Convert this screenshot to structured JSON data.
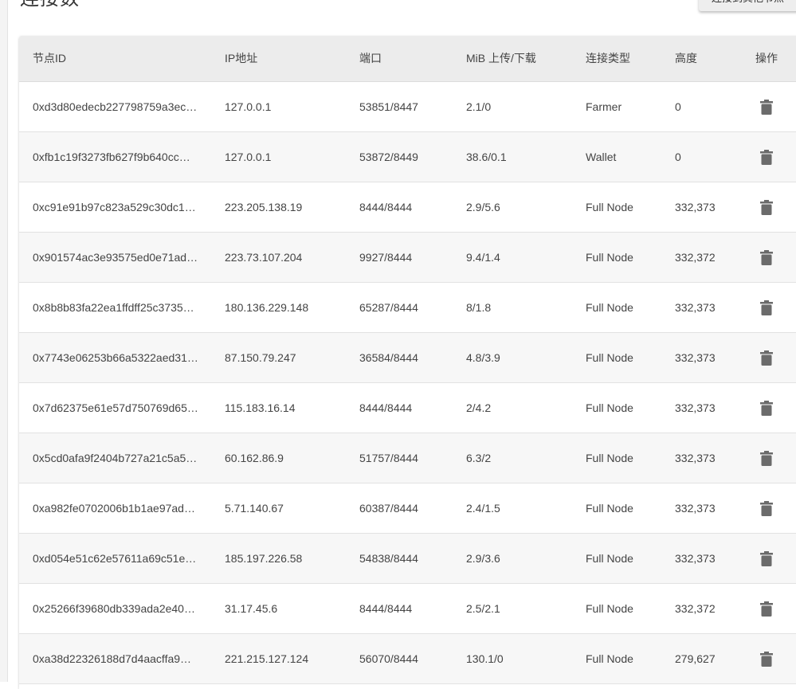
{
  "section": {
    "title": "连接数",
    "top_button_label": "连接到其他节点"
  },
  "table": {
    "headers": {
      "node_id": "节点ID",
      "ip": "IP地址",
      "port": "端口",
      "mib": "MiB 上传/下载",
      "type": "连接类型",
      "height": "高度",
      "action": "操作"
    },
    "rows": [
      {
        "node_id": "0xd3d80edecb227798759a3ec…",
        "ip": "127.0.0.1",
        "port": "53851/8447",
        "mib": "2.1/0",
        "type": "Farmer",
        "height": "0"
      },
      {
        "node_id": "0xfb1c19f3273fb627f9b640cc…",
        "ip": "127.0.0.1",
        "port": "53872/8449",
        "mib": "38.6/0.1",
        "type": "Wallet",
        "height": "0"
      },
      {
        "node_id": "0xc91e91b97c823a529c30dc1…",
        "ip": "223.205.138.19",
        "port": "8444/8444",
        "mib": "2.9/5.6",
        "type": "Full Node",
        "height": "332,373"
      },
      {
        "node_id": "0x901574ac3e93575ed0e71ad…",
        "ip": "223.73.107.204",
        "port": "9927/8444",
        "mib": "9.4/1.4",
        "type": "Full Node",
        "height": "332,372"
      },
      {
        "node_id": "0x8b8b83fa22ea1ffdff25c3735…",
        "ip": "180.136.229.148",
        "port": "65287/8444",
        "mib": "8/1.8",
        "type": "Full Node",
        "height": "332,373"
      },
      {
        "node_id": "0x7743e06253b66a5322aed31…",
        "ip": "87.150.79.247",
        "port": "36584/8444",
        "mib": "4.8/3.9",
        "type": "Full Node",
        "height": "332,373"
      },
      {
        "node_id": "0x7d62375e61e57d750769d65…",
        "ip": "115.183.16.14",
        "port": "8444/8444",
        "mib": "2/4.2",
        "type": "Full Node",
        "height": "332,373"
      },
      {
        "node_id": "0x5cd0afa9f2404b727a21c5a5…",
        "ip": "60.162.86.9",
        "port": "51757/8444",
        "mib": "6.3/2",
        "type": "Full Node",
        "height": "332,373"
      },
      {
        "node_id": "0xa982fe0702006b1b1ae97ad…",
        "ip": "5.71.140.67",
        "port": "60387/8444",
        "mib": "2.4/1.5",
        "type": "Full Node",
        "height": "332,373"
      },
      {
        "node_id": "0xd054e51c62e57611a69c51e…",
        "ip": "185.197.226.58",
        "port": "54838/8444",
        "mib": "2.9/3.6",
        "type": "Full Node",
        "height": "332,373"
      },
      {
        "node_id": "0x25266f39680db339ada2e40…",
        "ip": "31.17.45.6",
        "port": "8444/8444",
        "mib": "2.5/2.1",
        "type": "Full Node",
        "height": "332,372"
      },
      {
        "node_id": "0xa38d22326188d7d4aacffa9…",
        "ip": "221.215.127.124",
        "port": "56070/8444",
        "mib": "130.1/0",
        "type": "Full Node",
        "height": "279,627"
      }
    ]
  },
  "icons": {
    "delete": "trash-icon"
  },
  "colors": {
    "header_bg": "#ececec",
    "alt_row_bg": "#f7f7f7",
    "icon": "#6b6b6b"
  }
}
